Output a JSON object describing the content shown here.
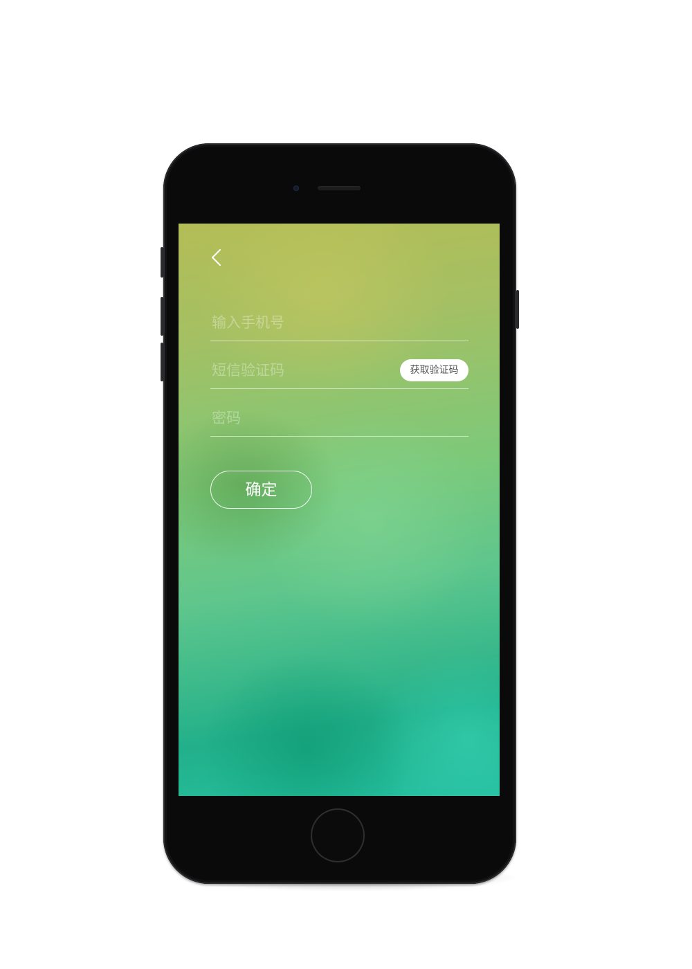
{
  "screen": {
    "back_icon": "chevron-left-icon",
    "phone_field": {
      "placeholder": "输入手机号",
      "value": ""
    },
    "sms_field": {
      "placeholder": "短信验证码",
      "value": "",
      "get_code_label": "获取验证码"
    },
    "password_field": {
      "placeholder": "密码",
      "value": ""
    },
    "confirm_label": "确定"
  },
  "colors": {
    "gradient_top": "#b4bd56",
    "gradient_middle": "#7cc97a",
    "gradient_bottom": "#25c0a1",
    "device_body": "#0a0a0b",
    "button_white": "#ffffff"
  }
}
